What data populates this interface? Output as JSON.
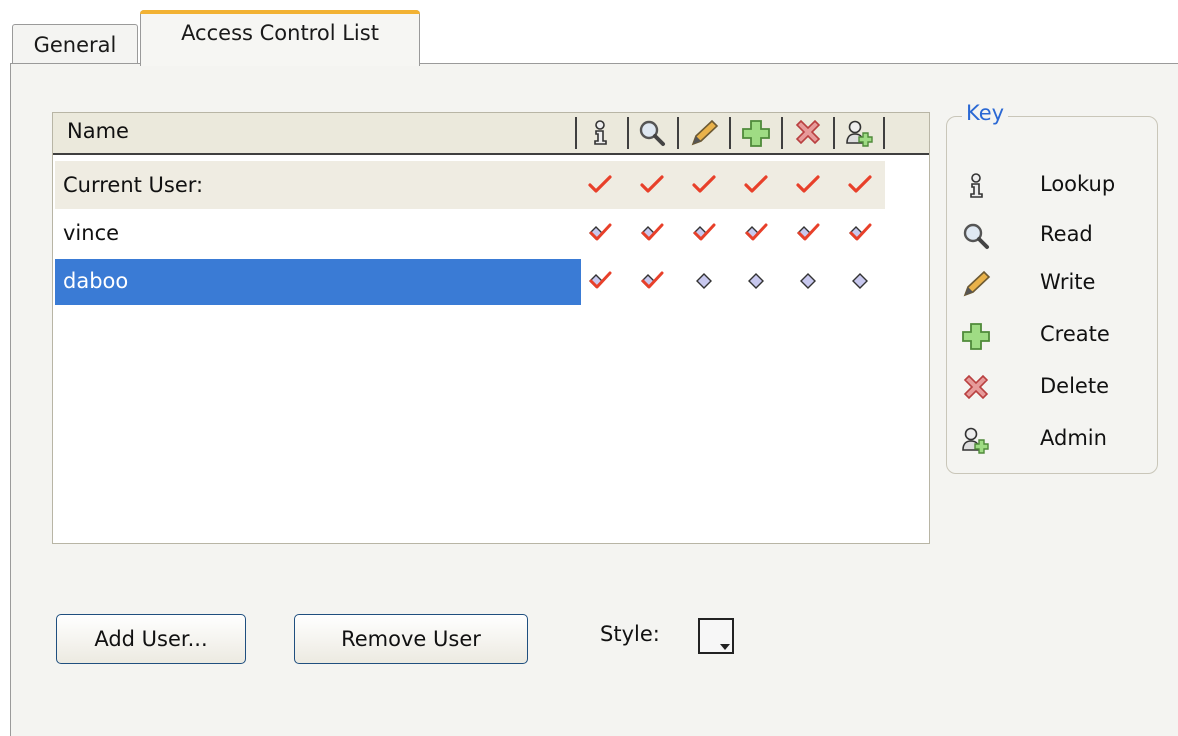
{
  "tabs": [
    {
      "label": "General",
      "active": false
    },
    {
      "label": "Access Control List",
      "active": true
    }
  ],
  "acl": {
    "header": {
      "name": "Name",
      "columns": [
        "lookup-icon",
        "read-icon",
        "write-icon",
        "create-icon",
        "delete-icon",
        "admin-icon"
      ]
    },
    "rows": [
      {
        "name": "Current User:",
        "perms": [
          "check",
          "check",
          "check",
          "check",
          "check",
          "check"
        ],
        "style": "current"
      },
      {
        "name": "vince",
        "perms": [
          "check-diamond",
          "check-diamond",
          "check-diamond",
          "check-diamond",
          "check-diamond",
          "check-diamond"
        ],
        "style": "normal"
      },
      {
        "name": "daboo",
        "perms": [
          "check-diamond",
          "check-diamond",
          "diamond",
          "diamond",
          "diamond",
          "diamond"
        ],
        "style": "selected"
      }
    ]
  },
  "key": {
    "title": "Key",
    "items": [
      {
        "icon": "lookup-icon",
        "label": "Lookup"
      },
      {
        "icon": "read-icon",
        "label": "Read"
      },
      {
        "icon": "write-icon",
        "label": "Write"
      },
      {
        "icon": "create-icon",
        "label": "Create"
      },
      {
        "icon": "delete-icon",
        "label": "Delete"
      },
      {
        "icon": "admin-icon",
        "label": "Admin"
      }
    ]
  },
  "buttons": {
    "add_user": "Add User...",
    "remove_user": "Remove User"
  },
  "style": {
    "label": "Style:"
  },
  "colors": {
    "selection": "#3a7bd5",
    "check": "#e8402a",
    "key_title": "#2a68d4",
    "tab_accent": "#f2b233"
  }
}
